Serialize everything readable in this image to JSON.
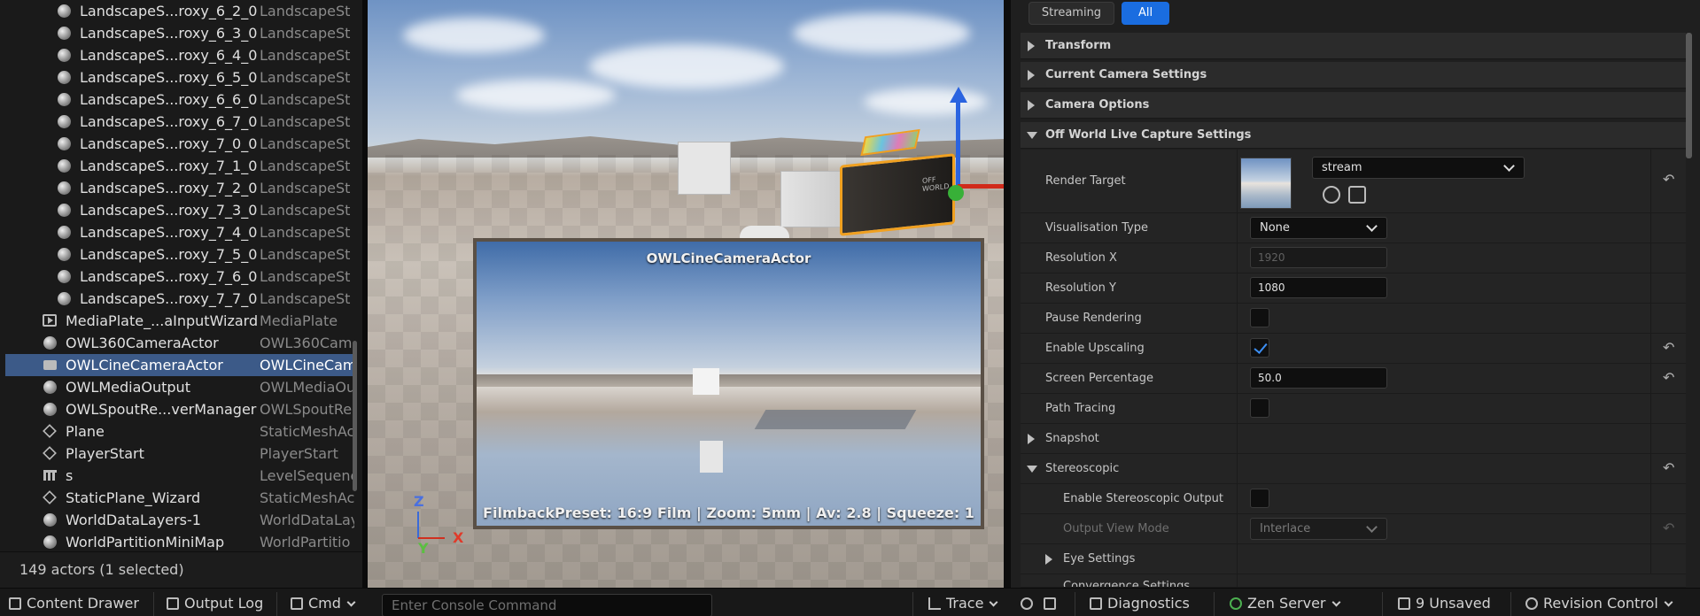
{
  "outliner": {
    "rows": [
      {
        "name": "LandscapeS...roxy_6_2_0",
        "type": "LandscapeSt",
        "icon": "sphere-icon",
        "indent": 1,
        "selected": false
      },
      {
        "name": "LandscapeS...roxy_6_3_0",
        "type": "LandscapeSt",
        "icon": "sphere-icon",
        "indent": 1,
        "selected": false
      },
      {
        "name": "LandscapeS...roxy_6_4_0",
        "type": "LandscapeSt",
        "icon": "sphere-icon",
        "indent": 1,
        "selected": false
      },
      {
        "name": "LandscapeS...roxy_6_5_0",
        "type": "LandscapeSt",
        "icon": "sphere-icon",
        "indent": 1,
        "selected": false
      },
      {
        "name": "LandscapeS...roxy_6_6_0",
        "type": "LandscapeSt",
        "icon": "sphere-icon",
        "indent": 1,
        "selected": false
      },
      {
        "name": "LandscapeS...roxy_6_7_0",
        "type": "LandscapeSt",
        "icon": "sphere-icon",
        "indent": 1,
        "selected": false
      },
      {
        "name": "LandscapeS...roxy_7_0_0",
        "type": "LandscapeSt",
        "icon": "sphere-icon",
        "indent": 1,
        "selected": false
      },
      {
        "name": "LandscapeS...roxy_7_1_0",
        "type": "LandscapeSt",
        "icon": "sphere-icon",
        "indent": 1,
        "selected": false
      },
      {
        "name": "LandscapeS...roxy_7_2_0",
        "type": "LandscapeSt",
        "icon": "sphere-icon",
        "indent": 1,
        "selected": false
      },
      {
        "name": "LandscapeS...roxy_7_3_0",
        "type": "LandscapeSt",
        "icon": "sphere-icon",
        "indent": 1,
        "selected": false
      },
      {
        "name": "LandscapeS...roxy_7_4_0",
        "type": "LandscapeSt",
        "icon": "sphere-icon",
        "indent": 1,
        "selected": false
      },
      {
        "name": "LandscapeS...roxy_7_5_0",
        "type": "LandscapeSt",
        "icon": "sphere-icon",
        "indent": 1,
        "selected": false
      },
      {
        "name": "LandscapeS...roxy_7_6_0",
        "type": "LandscapeSt",
        "icon": "sphere-icon",
        "indent": 1,
        "selected": false
      },
      {
        "name": "LandscapeS...roxy_7_7_0",
        "type": "LandscapeSt",
        "icon": "sphere-icon",
        "indent": 1,
        "selected": false
      },
      {
        "name": "MediaPlate_...aInputWizard",
        "type": "MediaPlate",
        "icon": "media-plate-icon",
        "indent": 0,
        "selected": false
      },
      {
        "name": "OWL360CameraActor",
        "type": "OWL360Cam",
        "icon": "sphere-icon",
        "indent": 0,
        "selected": false
      },
      {
        "name": "OWLCineCameraActor",
        "type": "OWLCineCam",
        "icon": "camera-icon",
        "indent": 0,
        "selected": true
      },
      {
        "name": "OWLMediaOutput",
        "type": "OWLMediaOu",
        "icon": "sphere-icon",
        "indent": 0,
        "selected": false
      },
      {
        "name": "OWLSpoutRe...verManager",
        "type": "OWLSpoutRe",
        "icon": "sphere-icon",
        "indent": 0,
        "selected": false
      },
      {
        "name": "Plane",
        "type": "StaticMeshAc",
        "icon": "cube-icon",
        "indent": 0,
        "selected": false
      },
      {
        "name": "PlayerStart",
        "type": "PlayerStart",
        "icon": "cube-icon",
        "indent": 0,
        "selected": false
      },
      {
        "name": "s",
        "type": "LevelSequence",
        "icon": "clapper-icon",
        "indent": 0,
        "selected": false
      },
      {
        "name": "StaticPlane_Wizard",
        "type": "StaticMeshAc",
        "icon": "cube-icon",
        "indent": 0,
        "selected": false
      },
      {
        "name": "WorldDataLayers-1",
        "type": "WorldDataLay",
        "icon": "sphere-icon",
        "indent": 0,
        "selected": false
      },
      {
        "name": "WorldPartitionMiniMap",
        "type": "WorldPartitio",
        "icon": "sphere-icon",
        "indent": 0,
        "selected": false
      }
    ],
    "footer": "149 actors (1 selected)"
  },
  "viewport": {
    "pip_title": "OWLCineCameraActor",
    "pip_info": "FilmbackPreset: 16:9 Film | Zoom: 5mm | Av: 2.8 | Squeeze: 1",
    "axis_z": "Z",
    "axis_x": "X",
    "axis_y": "Y"
  },
  "details": {
    "filters": {
      "stream": "Streaming",
      "all": "All"
    },
    "sections": {
      "transform": "Transform",
      "current_camera": "Current Camera Settings",
      "camera_options": "Camera Options",
      "owl": "Off World Live Capture Settings",
      "snapshot": "Snapshot",
      "stereoscopic": "Stereoscopic",
      "eye_settings": "Eye Settings",
      "convergence": "Convergence Settings"
    },
    "props": {
      "render_target": {
        "label": "Render Target",
        "value": "stream"
      },
      "visualisation_type": {
        "label": "Visualisation Type",
        "value": "None"
      },
      "resolution_x": {
        "label": "Resolution X",
        "value": "1920"
      },
      "resolution_y": {
        "label": "Resolution Y",
        "value": "1080"
      },
      "pause_rendering": {
        "label": "Pause Rendering",
        "checked": false
      },
      "enable_upscaling": {
        "label": "Enable Upscaling",
        "checked": true
      },
      "screen_percentage": {
        "label": "Screen Percentage",
        "value": "50.0"
      },
      "path_tracing": {
        "label": "Path Tracing",
        "checked": false
      },
      "enable_stereo_output": {
        "label": "Enable Stereoscopic Output",
        "checked": false
      },
      "output_view_mode": {
        "label": "Output View Mode",
        "value": "Interlace"
      }
    }
  },
  "bottombar": {
    "content_drawer": "Content Drawer",
    "output_log": "Output Log",
    "cmd": "Cmd",
    "console_placeholder": "Enter Console Command",
    "trace": "Trace",
    "diagnostics": "Diagnostics",
    "zen_server": "Zen Server",
    "unsaved": "9 Unsaved",
    "revision_control": "Revision Control"
  },
  "colors": {
    "selection": "#3c5a88",
    "accent": "#1a6de0",
    "gizmo_x": "#d12a1a",
    "gizmo_z": "#2a63e0",
    "gizmo_center": "#38b038",
    "selection_outline": "#f0a020"
  }
}
